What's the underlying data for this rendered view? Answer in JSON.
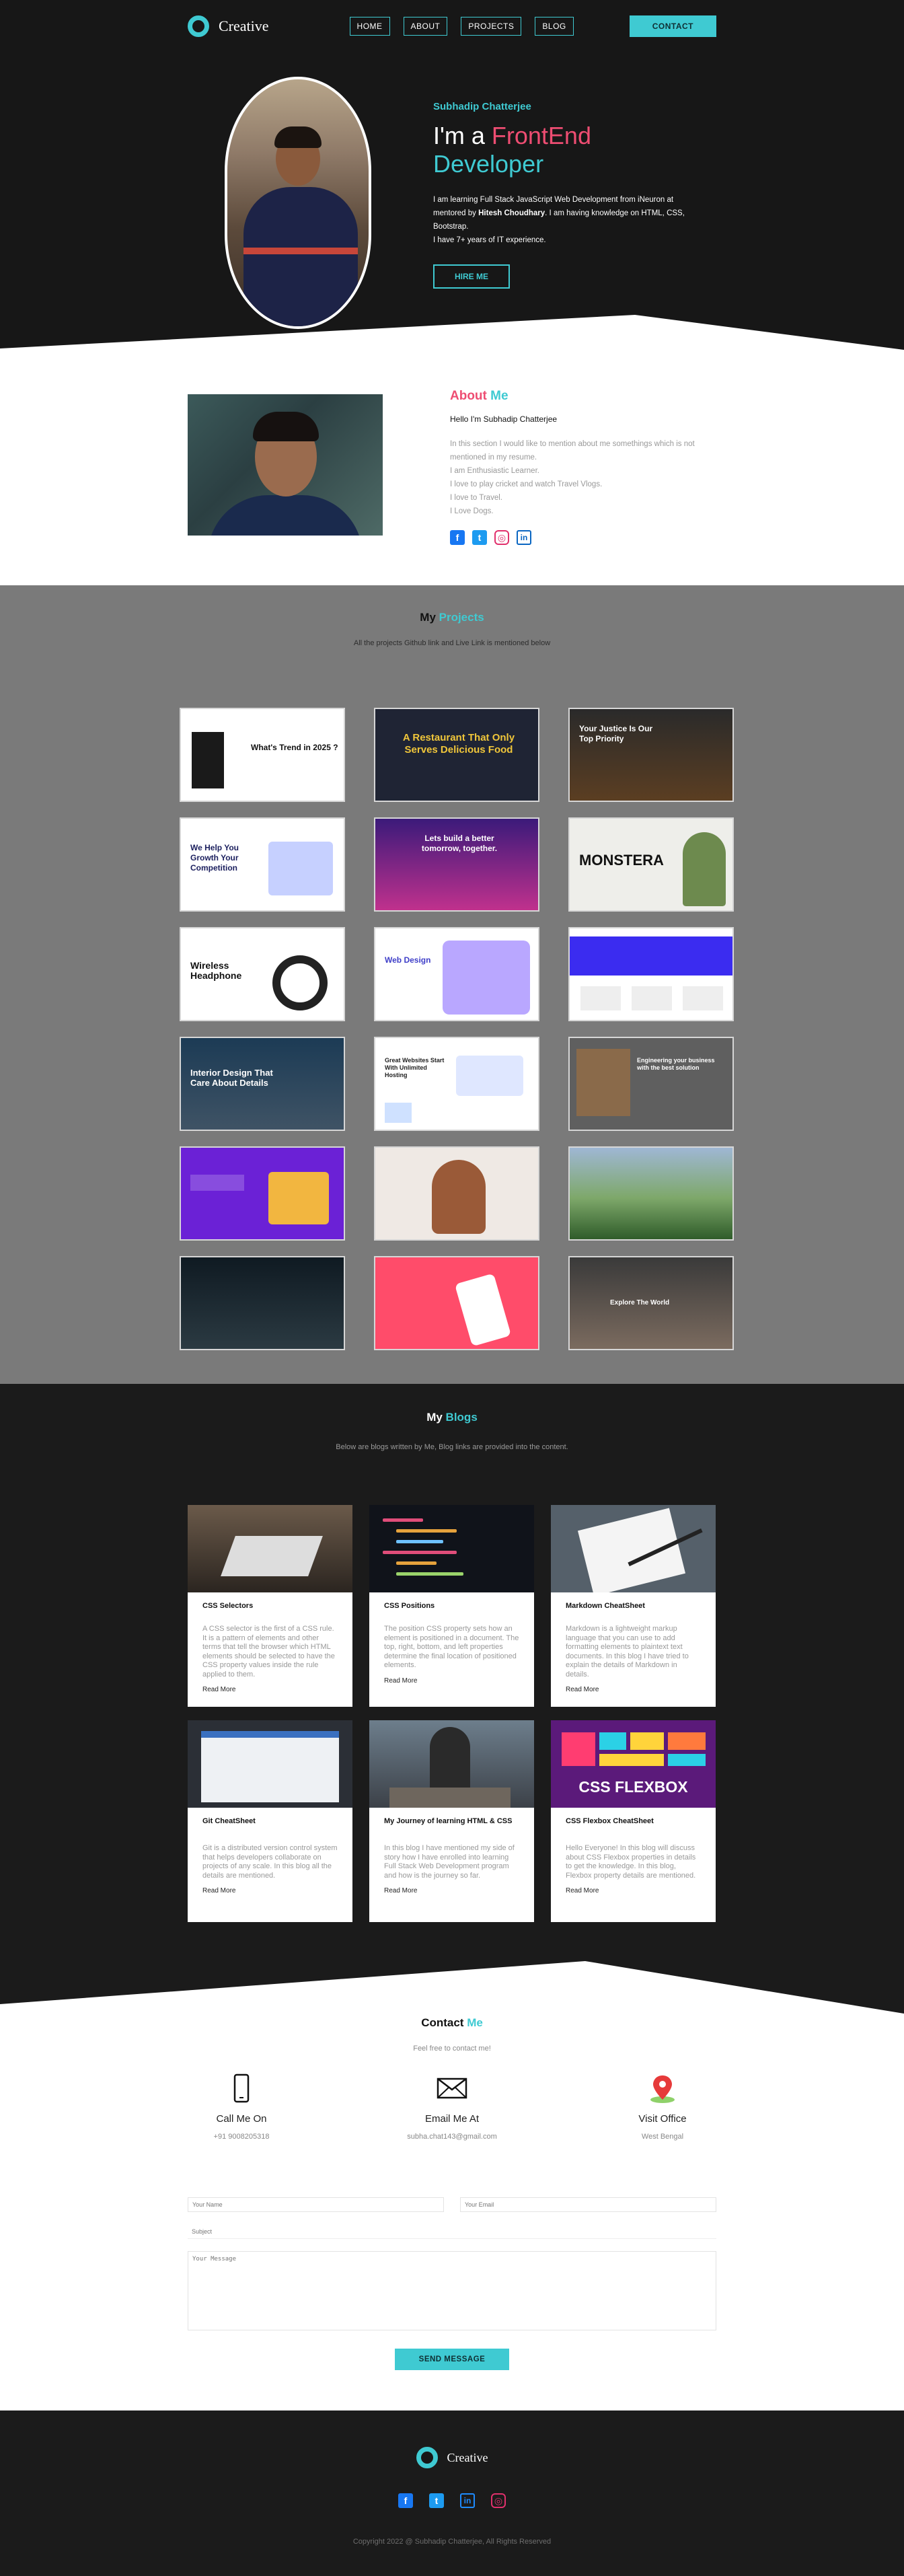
{
  "brand": {
    "name": "Creative"
  },
  "nav": {
    "links": [
      "HOME",
      "ABOUT",
      "PROJECTS",
      "BLOG"
    ],
    "contact_label": "CONTACT"
  },
  "hero": {
    "name": "Subhadip Chatterjee",
    "title_prefix": "I'm a ",
    "title_pink": "FrontEnd",
    "title_suffix": " Developer",
    "desc_1": "I am learning Full Stack JavaScript Web Development from iNeuron at mentored by ",
    "desc_mentor": "Hitesh Choudhary",
    "desc_2": ". I am having knowledge on HTML, CSS, Bootstrap.",
    "desc_3": "I have 7+ years of IT experience.",
    "hire_label": "HIRE ME"
  },
  "about": {
    "title_a": "About ",
    "title_b": "Me",
    "hello": "Hello I'm Subhadip Chatterjee",
    "lines": [
      "In this section I would like to mention about me somethings which is not mentioned in my resume.",
      "I am Enthusiastic Learner.",
      "I love to play cricket and watch Travel Vlogs.",
      "I love to Travel.",
      "I Love Dogs."
    ]
  },
  "projects": {
    "title_a": "My ",
    "title_b": "Projects",
    "subtitle": "All the projects Github link and Live Link is mentioned below",
    "items": [
      {
        "caption": "What's Trend in 2025 ?"
      },
      {
        "caption": "A Restaurant That Only Serves Delicious Food"
      },
      {
        "caption": "Your Justice Is Our Top Priority"
      },
      {
        "caption": "We Help You Growth Your Competition"
      },
      {
        "caption": "Lets build a better tomorrow, together."
      },
      {
        "caption": "MONSTERA"
      },
      {
        "caption": "Wireless Headphone"
      },
      {
        "caption": "Web Design"
      },
      {
        "caption": ""
      },
      {
        "caption": "Interior Design That Care About Details"
      },
      {
        "caption": "Great Websites Start With Unlimited Hosting"
      },
      {
        "caption": "Engineering your business with the best solution"
      },
      {
        "caption": ""
      },
      {
        "caption": ""
      },
      {
        "caption": ""
      },
      {
        "caption": ""
      },
      {
        "caption": ""
      },
      {
        "caption": "Explore The World"
      }
    ]
  },
  "blogs": {
    "title_a": "My ",
    "title_b": "Blogs",
    "subtitle": "Below are blogs written by Me, Blog links are provided into the content.",
    "read_more": "Read More",
    "items": [
      {
        "title": "CSS Selectors",
        "desc": "A CSS selector is the first of a CSS rule. It is a pattern of elements and other terms that tell the browser which HTML elements should be selected to have the CSS property values inside the rule applied to them."
      },
      {
        "title": "CSS Positions",
        "desc": "The position CSS property sets how an element is positioned in a document. The top, right, bottom, and left properties determine the final location of positioned elements."
      },
      {
        "title": "Markdown CheatSheet",
        "desc": "Markdown is a lightweight markup language that you can use to add formatting elements to plaintext text documents. In this blog I have tried to explain the details of Markdown in details."
      },
      {
        "title": "Git CheatSheet",
        "desc": "Git is a distributed version control system that helps developers collaborate on projects of any scale. In this blog all the details are mentioned."
      },
      {
        "title": "My Journey of learning HTML & CSS",
        "desc": "In this blog I have mentioned my side of story how I have enrolled into learning Full Stack Web Development program and how is the journey so far."
      },
      {
        "title": "CSS Flexbox CheatSheet",
        "desc": "Hello Everyone! In this blog will discuss about CSS Flexbox properties in details to get the knowledge. In this blog, Flexbox property details are mentioned."
      }
    ],
    "flexbox_label": "CSS FLEXBOX"
  },
  "contact": {
    "title_a": "Contact ",
    "title_b": "Me",
    "subtitle": "Feel free to contact me!",
    "items": [
      {
        "label": "Call Me On",
        "value": "+91 9008205318",
        "icon": "phone-icon"
      },
      {
        "label": "Email Me At",
        "value": "subha.chat143@gmail.com",
        "icon": "mail-icon"
      },
      {
        "label": "Visit Office",
        "value": "West Bengal",
        "icon": "map-pin-icon"
      }
    ],
    "form": {
      "name_placeholder": "Your Name",
      "email_placeholder": "Your Email",
      "subject_placeholder": "Subject",
      "message_placeholder": "Your Message",
      "send_label": "SEND MESSAGE"
    }
  },
  "footer": {
    "copyright": "Copyright 2022 @ Subhadip Chatterjee, All Rights Reserved"
  },
  "colors": {
    "accent": "#3fcad2",
    "pink": "#ee4d72",
    "dark": "#171717",
    "grey": "#7a7a7a"
  }
}
